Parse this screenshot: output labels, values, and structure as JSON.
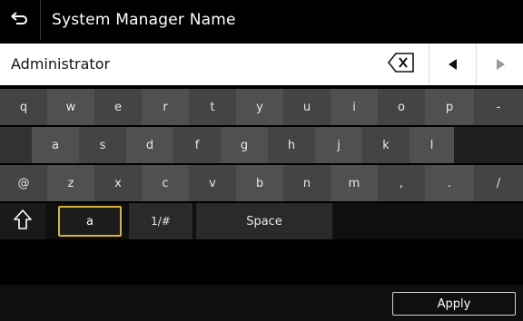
{
  "header": {
    "title": "System Manager Name"
  },
  "input": {
    "value": "Administrator"
  },
  "keyboard": {
    "row1": [
      "q",
      "w",
      "e",
      "r",
      "t",
      "y",
      "u",
      "i",
      "o",
      "p",
      "-"
    ],
    "row2": [
      "a",
      "s",
      "d",
      "f",
      "g",
      "h",
      "j",
      "k",
      "l"
    ],
    "row3": [
      "@",
      "z",
      "x",
      "c",
      "v",
      "b",
      "n",
      "m",
      ",",
      ".",
      "/"
    ],
    "mode_letter": "a",
    "mode_symbol": "1/#",
    "space": "Space"
  },
  "footer": {
    "apply_label": "Apply"
  },
  "icons": {
    "back": "back-arrow-icon",
    "backspace": "backspace-icon",
    "cursor_left": "triangle-left-icon",
    "cursor_right": "triangle-right-icon",
    "shift": "shift-up-arrow-icon"
  },
  "colors": {
    "highlight": "#d8b13a"
  }
}
